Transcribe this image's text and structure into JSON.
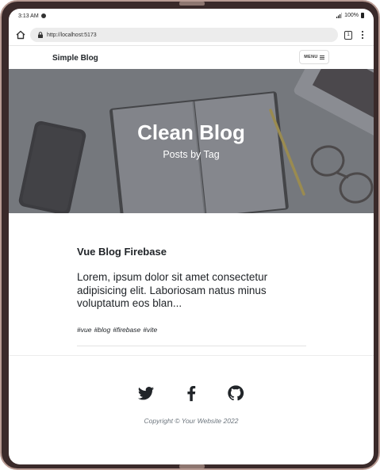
{
  "status_bar": {
    "time": "3:13 AM",
    "battery": "100%"
  },
  "browser": {
    "url": "http://localhost:5173",
    "tab_count": "1"
  },
  "site": {
    "brand": "Simple Blog",
    "menu_label": "MENU"
  },
  "hero": {
    "title": "Clean Blog",
    "subtitle": "Posts by Tag"
  },
  "post": {
    "title": "Vue Blog Firebase",
    "excerpt": "Lorem, ipsum dolor sit amet consectetur adipisicing elit. Laboriosam natus minus voluptatum eos blan...",
    "tags": [
      "#vue",
      "#blog",
      "#firebase",
      "#vite"
    ]
  },
  "footer": {
    "social": [
      "twitter-icon",
      "facebook-icon",
      "github-icon"
    ],
    "copyright": "Copyright © Your Website 2022"
  }
}
